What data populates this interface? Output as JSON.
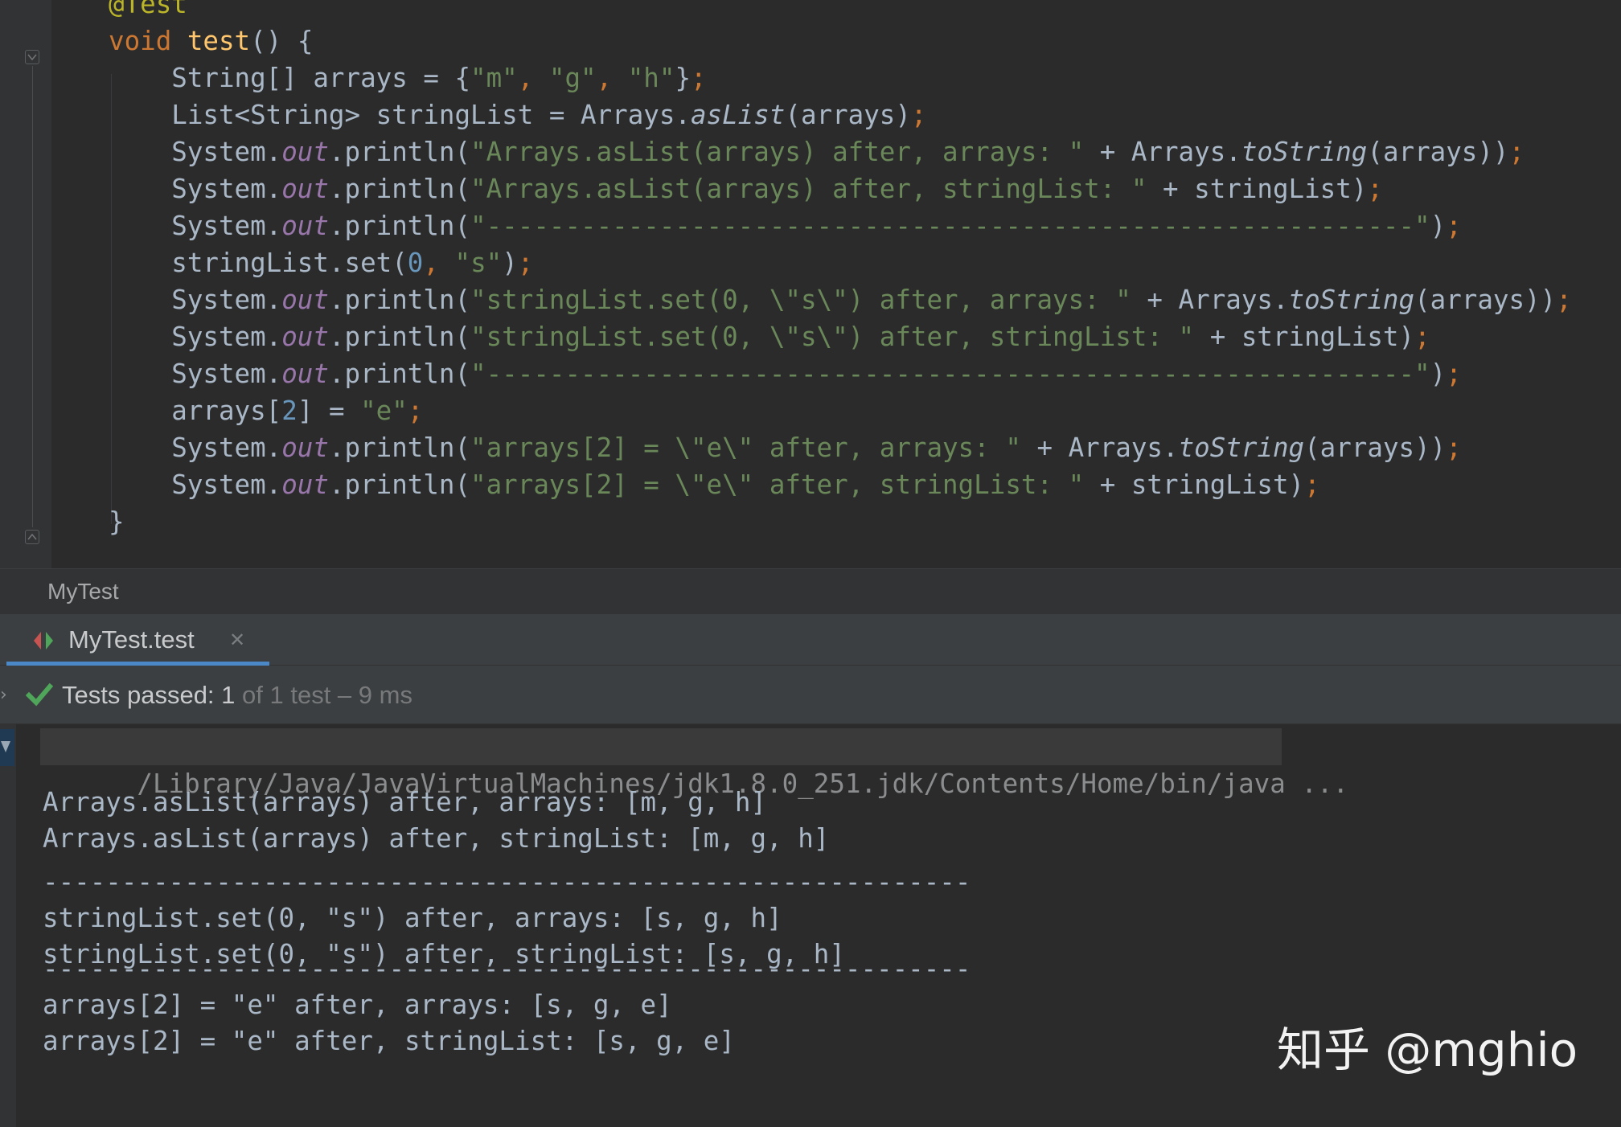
{
  "editor": {
    "lines": [
      [
        {
          "t": "@Test",
          "c": "ann"
        }
      ],
      [
        {
          "t": "void",
          "c": "kw"
        },
        {
          "t": " ",
          "c": "plain"
        },
        {
          "t": "test",
          "c": "method"
        },
        {
          "t": "() {",
          "c": "plain"
        }
      ],
      [
        {
          "t": "    String[] arrays = {",
          "c": "plain"
        },
        {
          "t": "\"m\"",
          "c": "str"
        },
        {
          "t": ", ",
          "c": "punct"
        },
        {
          "t": "\"g\"",
          "c": "str"
        },
        {
          "t": ", ",
          "c": "punct"
        },
        {
          "t": "\"h\"",
          "c": "str"
        },
        {
          "t": "}",
          "c": "plain"
        },
        {
          "t": ";",
          "c": "punct"
        }
      ],
      [
        {
          "t": "    List<String> stringList = Arrays.",
          "c": "plain"
        },
        {
          "t": "asList",
          "c": "static"
        },
        {
          "t": "(arrays)",
          "c": "plain"
        },
        {
          "t": ";",
          "c": "punct"
        }
      ],
      [
        {
          "t": "    System.",
          "c": "plain"
        },
        {
          "t": "out",
          "c": "field"
        },
        {
          "t": ".println(",
          "c": "plain"
        },
        {
          "t": "\"Arrays.asList(arrays) after, arrays: \"",
          "c": "str"
        },
        {
          "t": " + Arrays.",
          "c": "plain"
        },
        {
          "t": "toString",
          "c": "static"
        },
        {
          "t": "(arrays))",
          "c": "plain"
        },
        {
          "t": ";",
          "c": "punct"
        }
      ],
      [
        {
          "t": "    System.",
          "c": "plain"
        },
        {
          "t": "out",
          "c": "field"
        },
        {
          "t": ".println(",
          "c": "plain"
        },
        {
          "t": "\"Arrays.asList(arrays) after, stringList: \"",
          "c": "str"
        },
        {
          "t": " + stringList)",
          "c": "plain"
        },
        {
          "t": ";",
          "c": "punct"
        }
      ],
      [
        {
          "t": "    System.",
          "c": "plain"
        },
        {
          "t": "out",
          "c": "field"
        },
        {
          "t": ".println(",
          "c": "plain"
        },
        {
          "t": "\"-----------------------------------------------------------\"",
          "c": "str"
        },
        {
          "t": ")",
          "c": "plain"
        },
        {
          "t": ";",
          "c": "punct"
        }
      ],
      [
        {
          "t": "    stringList.set(",
          "c": "plain"
        },
        {
          "t": "0",
          "c": "num"
        },
        {
          "t": ", ",
          "c": "punct"
        },
        {
          "t": "\"s\"",
          "c": "str"
        },
        {
          "t": ")",
          "c": "plain"
        },
        {
          "t": ";",
          "c": "punct"
        }
      ],
      [
        {
          "t": "    System.",
          "c": "plain"
        },
        {
          "t": "out",
          "c": "field"
        },
        {
          "t": ".println(",
          "c": "plain"
        },
        {
          "t": "\"stringList.set(0, \\\"s\\\") after, arrays: \"",
          "c": "str"
        },
        {
          "t": " + Arrays.",
          "c": "plain"
        },
        {
          "t": "toString",
          "c": "static"
        },
        {
          "t": "(arrays))",
          "c": "plain"
        },
        {
          "t": ";",
          "c": "punct"
        }
      ],
      [
        {
          "t": "    System.",
          "c": "plain"
        },
        {
          "t": "out",
          "c": "field"
        },
        {
          "t": ".println(",
          "c": "plain"
        },
        {
          "t": "\"stringList.set(0, \\\"s\\\") after, stringList: \"",
          "c": "str"
        },
        {
          "t": " + stringList)",
          "c": "plain"
        },
        {
          "t": ";",
          "c": "punct"
        }
      ],
      [
        {
          "t": "    System.",
          "c": "plain"
        },
        {
          "t": "out",
          "c": "field"
        },
        {
          "t": ".println(",
          "c": "plain"
        },
        {
          "t": "\"-----------------------------------------------------------\"",
          "c": "str"
        },
        {
          "t": ")",
          "c": "plain"
        },
        {
          "t": ";",
          "c": "punct"
        }
      ],
      [
        {
          "t": "    arrays[",
          "c": "plain"
        },
        {
          "t": "2",
          "c": "num"
        },
        {
          "t": "] = ",
          "c": "plain"
        },
        {
          "t": "\"e\"",
          "c": "str"
        },
        {
          "t": ";",
          "c": "punct"
        }
      ],
      [
        {
          "t": "    System.",
          "c": "plain"
        },
        {
          "t": "out",
          "c": "field"
        },
        {
          "t": ".println(",
          "c": "plain"
        },
        {
          "t": "\"arrays[2] = \\\"e\\\" after, arrays: \"",
          "c": "str"
        },
        {
          "t": " + Arrays.",
          "c": "plain"
        },
        {
          "t": "toString",
          "c": "static"
        },
        {
          "t": "(arrays))",
          "c": "plain"
        },
        {
          "t": ";",
          "c": "punct"
        }
      ],
      [
        {
          "t": "    System.",
          "c": "plain"
        },
        {
          "t": "out",
          "c": "field"
        },
        {
          "t": ".println(",
          "c": "plain"
        },
        {
          "t": "\"arrays[2] = \\\"e\\\" after, stringList: \"",
          "c": "str"
        },
        {
          "t": " + stringList)",
          "c": "plain"
        },
        {
          "t": ";",
          "c": "punct"
        }
      ],
      [
        {
          "t": "}",
          "c": "plain"
        }
      ]
    ],
    "fold_open_icon": "fold-open-icon",
    "fold_close_icon": "fold-close-icon"
  },
  "breadcrumb": {
    "label": "MyTest"
  },
  "run_panel": {
    "tab": {
      "label": "MyTest.test",
      "icon": "test-run-icon",
      "close_glyph": "✕"
    },
    "status": {
      "expander_glyph": "›",
      "check_icon": "check-icon",
      "passed_label": "Tests passed: 1",
      "rest_label": " of 1 test – 9 ms",
      "check_color": "#4fa55a"
    }
  },
  "console": {
    "command": "/Library/Java/JavaVirtualMachines/jdk1.8.0_251.jdk/Contents/Home/bin/java ...",
    "output": [
      "Arrays.asList(arrays) after, arrays: [m, g, h]",
      "Arrays.asList(arrays) after, stringList: [m, g, h]",
      "-----------------------------------------------------------",
      "stringList.set(0, \"s\") after, arrays: [s, g, h]",
      "stringList.set(0, \"s\") after, stringList: [s, g, h]",
      "-----------------------------------------------------------",
      "arrays[2] = \"e\" after, arrays: [s, g, e]",
      "arrays[2] = \"e\" after, stringList: [s, g, e]"
    ]
  },
  "watermark": {
    "text": "知乎 @mghio"
  },
  "colors": {
    "editor_bg": "#2b2b2b",
    "keyword": "#cc7832",
    "string": "#6a8759",
    "number": "#6897bb",
    "field": "#9876aa",
    "method": "#ffc66d",
    "annotation": "#bbb529",
    "accent": "#4a88c7"
  }
}
